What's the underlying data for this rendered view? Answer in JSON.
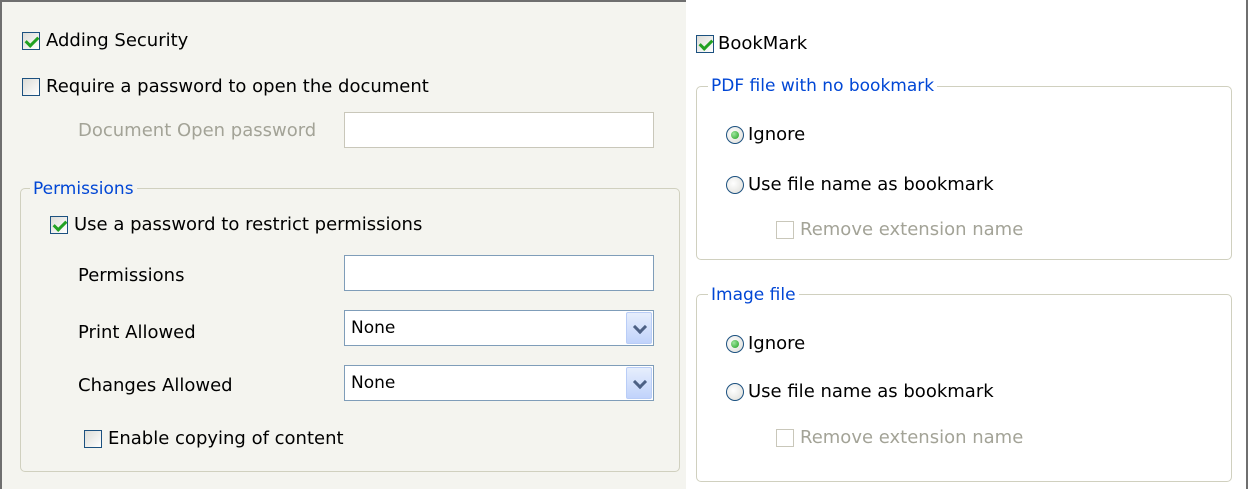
{
  "security": {
    "adding_security": {
      "label": "Adding Security",
      "checked": true
    },
    "require_password": {
      "label": "Require a password to open the document",
      "checked": false
    },
    "open_password": {
      "label": "Document Open password",
      "value": ""
    },
    "permissions_group": {
      "legend": "Permissions",
      "use_password": {
        "label": "Use a password to restrict permissions",
        "checked": true
      },
      "permissions_field": {
        "label": "Permissions",
        "value": ""
      },
      "print_allowed": {
        "label": "Print Allowed",
        "value": "None"
      },
      "changes_allowed": {
        "label": "Changes Allowed",
        "value": "None"
      },
      "enable_copying": {
        "label": "Enable copying of content",
        "checked": false
      }
    }
  },
  "bookmark": {
    "enabled": {
      "label": "BookMark",
      "checked": true
    },
    "pdf_group": {
      "legend": "PDF file with no bookmark",
      "ignore": {
        "label": "Ignore",
        "selected": true
      },
      "use_file_name": {
        "label": "Use file name as bookmark",
        "selected": false
      },
      "remove_extension": {
        "label": "Remove extension name",
        "checked": false
      }
    },
    "image_group": {
      "legend": "Image file",
      "ignore": {
        "label": "Ignore",
        "selected": true
      },
      "use_file_name": {
        "label": "Use file name as bookmark",
        "selected": false
      },
      "remove_extension": {
        "label": "Remove extension name",
        "checked": false
      }
    }
  },
  "colors": {
    "accent": "#0046d5",
    "check": "#21a121",
    "panel_bg": "#f4f4ef",
    "disabled_text": "#a3a397"
  }
}
